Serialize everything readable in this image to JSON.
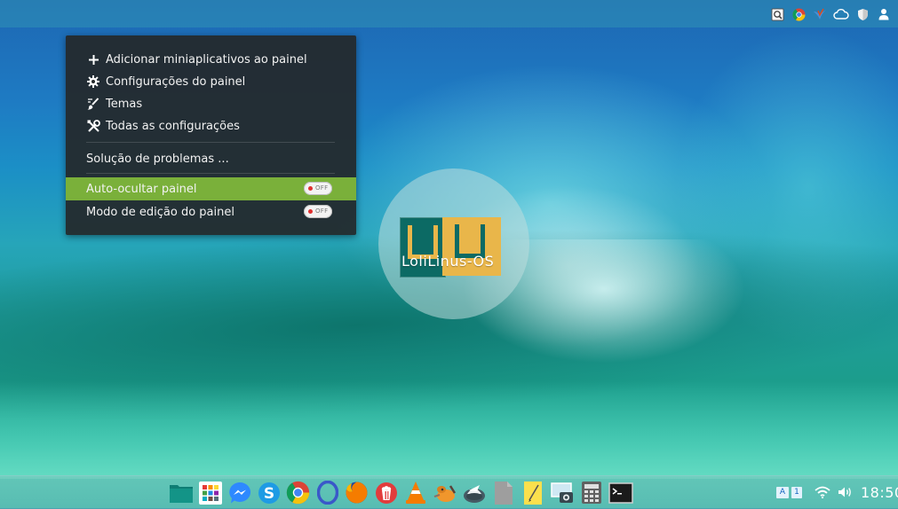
{
  "context_menu": {
    "items": [
      {
        "icon": "plus-icon",
        "label": "Adicionar miniaplicativos ao painel"
      },
      {
        "icon": "gear-icon",
        "label": "Configurações do painel"
      },
      {
        "icon": "brush-icon",
        "label": "Temas"
      },
      {
        "icon": "tools-icon",
        "label": "Todas as configurações"
      }
    ],
    "troubleshoot_label": "Solução de problemas ...",
    "toggles": [
      {
        "label": "Auto-ocultar painel",
        "state": "OFF",
        "highlighted": true
      },
      {
        "label": "Modo de edição do painel",
        "state": "OFF",
        "highlighted": false
      }
    ]
  },
  "logo": {
    "text": "LoliLinus-OS"
  },
  "top_tray": [
    "screenshot-icon",
    "chrome-icon",
    "pidgin-icon",
    "cloud-icon",
    "shield-icon",
    "user-icon"
  ],
  "dock": [
    "files-icon",
    "app-grid-icon",
    "messenger-icon",
    "skype-icon",
    "chrome-icon",
    "opera-icon",
    "firefox-icon",
    "popcorn-icon",
    "vlc-icon",
    "gimp-icon",
    "inkscape-icon",
    "document-icon",
    "notes-icon",
    "screenshot-icon",
    "calculator-icon",
    "terminal-icon"
  ],
  "bottom_tray": {
    "keyboard_label": "A",
    "workspace_label": "1",
    "clock": "18:50"
  },
  "colors": {
    "menu_bg": "#23282a",
    "menu_highlight": "#7ab03a"
  }
}
